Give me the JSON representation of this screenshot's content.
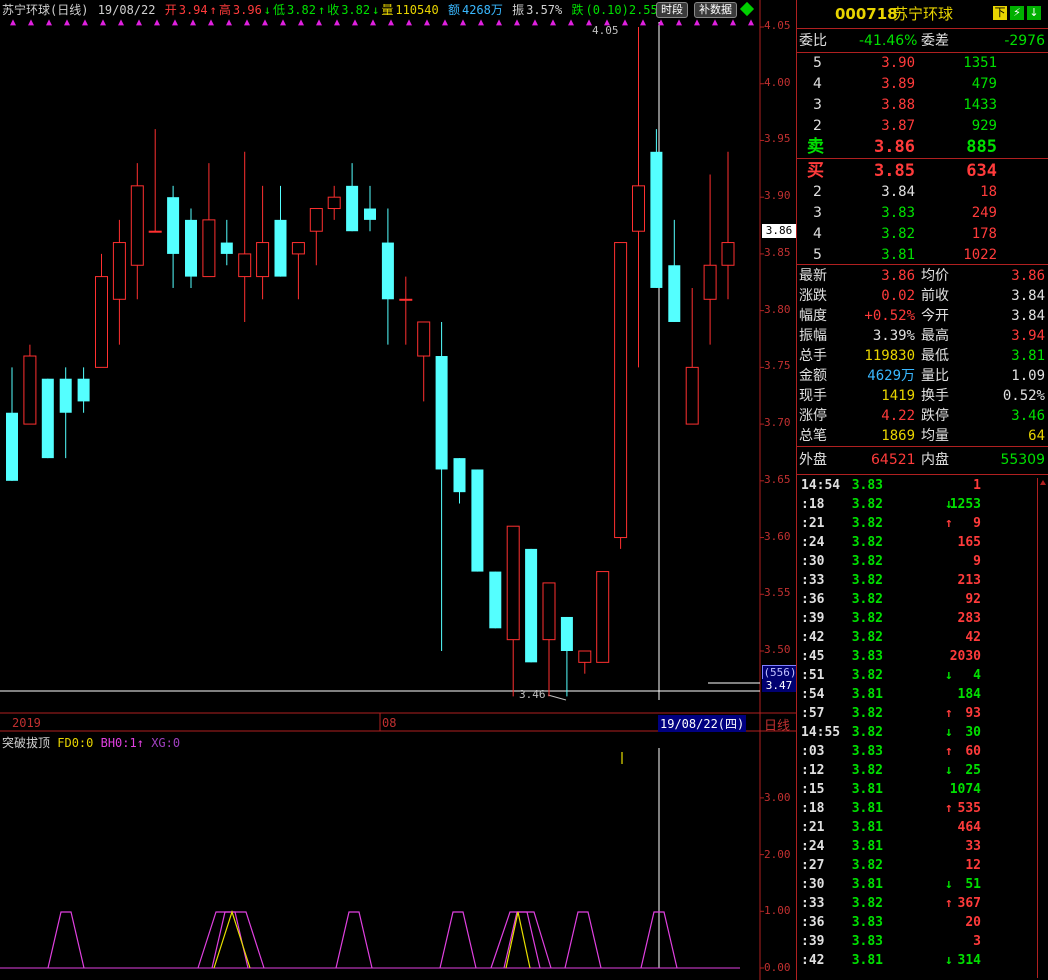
{
  "header": {
    "title": "苏宁环球(日线)",
    "date": "19/08/22",
    "open_label": "开",
    "open": "3.94",
    "high_label": "高",
    "high": "3.96",
    "low_label": "低",
    "low": "3.82",
    "close_label": "收",
    "close": "3.82",
    "vol_label": "量",
    "vol": "110540",
    "amt_label": "额",
    "amt": "4268万",
    "amp_label": "振",
    "amp": "3.57%",
    "chg_label": "跌",
    "chg": "(0.10)2.55%",
    "btn_period": "时段",
    "btn_supplement": "补数据"
  },
  "chart": {
    "y_ticks": [
      "4.05",
      "4.00",
      "3.95",
      "3.90",
      "3.85",
      "3.80",
      "3.75",
      "3.70",
      "3.65",
      "3.60",
      "3.55",
      "3.50"
    ],
    "current_price_tag": "3.86",
    "max_marker": "4.05",
    "min_marker": "3.46",
    "bottom_tag_1": "(556)",
    "bottom_tag_2": "3.47",
    "x_labels": [
      "2019",
      "08"
    ],
    "cursor_date": "19/08/22(四)",
    "period_label": "日线",
    "candles": [
      {
        "o": 3.71,
        "h": 3.75,
        "l": 3.65,
        "c": 3.65
      },
      {
        "o": 3.7,
        "h": 3.77,
        "l": 3.7,
        "c": 3.76
      },
      {
        "o": 3.74,
        "h": 3.74,
        "l": 3.67,
        "c": 3.67
      },
      {
        "o": 3.74,
        "h": 3.75,
        "l": 3.67,
        "c": 3.71
      },
      {
        "o": 3.74,
        "h": 3.75,
        "l": 3.71,
        "c": 3.72
      },
      {
        "o": 3.75,
        "h": 3.85,
        "l": 3.75,
        "c": 3.83
      },
      {
        "o": 3.81,
        "h": 3.88,
        "l": 3.77,
        "c": 3.86
      },
      {
        "o": 3.84,
        "h": 3.93,
        "l": 3.81,
        "c": 3.91
      },
      {
        "o": 3.87,
        "h": 3.96,
        "l": 3.87,
        "c": 3.87
      },
      {
        "o": 3.9,
        "h": 3.91,
        "l": 3.82,
        "c": 3.85
      },
      {
        "o": 3.88,
        "h": 3.89,
        "l": 3.82,
        "c": 3.83
      },
      {
        "o": 3.83,
        "h": 3.93,
        "l": 3.83,
        "c": 3.88
      },
      {
        "o": 3.86,
        "h": 3.88,
        "l": 3.84,
        "c": 3.85
      },
      {
        "o": 3.83,
        "h": 3.94,
        "l": 3.79,
        "c": 3.85
      },
      {
        "o": 3.83,
        "h": 3.91,
        "l": 3.81,
        "c": 3.86
      },
      {
        "o": 3.88,
        "h": 3.91,
        "l": 3.83,
        "c": 3.83
      },
      {
        "o": 3.85,
        "h": 3.86,
        "l": 3.81,
        "c": 3.86
      },
      {
        "o": 3.87,
        "h": 3.89,
        "l": 3.84,
        "c": 3.89
      },
      {
        "o": 3.89,
        "h": 3.91,
        "l": 3.88,
        "c": 3.9
      },
      {
        "o": 3.91,
        "h": 3.93,
        "l": 3.87,
        "c": 3.87
      },
      {
        "o": 3.89,
        "h": 3.91,
        "l": 3.87,
        "c": 3.88
      },
      {
        "o": 3.86,
        "h": 3.89,
        "l": 3.77,
        "c": 3.81
      },
      {
        "o": 3.81,
        "h": 3.83,
        "l": 3.77,
        "c": 3.81
      },
      {
        "o": 3.76,
        "h": 3.79,
        "l": 3.72,
        "c": 3.79
      },
      {
        "o": 3.76,
        "h": 3.79,
        "l": 3.5,
        "c": 3.66
      },
      {
        "o": 3.67,
        "h": 3.67,
        "l": 3.63,
        "c": 3.64
      },
      {
        "o": 3.66,
        "h": 3.66,
        "l": 3.57,
        "c": 3.57
      },
      {
        "o": 3.57,
        "h": 3.57,
        "l": 3.52,
        "c": 3.52
      },
      {
        "o": 3.51,
        "h": 3.61,
        "l": 3.46,
        "c": 3.61
      },
      {
        "o": 3.59,
        "h": 3.59,
        "l": 3.49,
        "c": 3.49
      },
      {
        "o": 3.51,
        "h": 3.56,
        "l": 3.46,
        "c": 3.56
      },
      {
        "o": 3.53,
        "h": 3.53,
        "l": 3.46,
        "c": 3.5
      },
      {
        "o": 3.49,
        "h": 3.5,
        "l": 3.48,
        "c": 3.5
      },
      {
        "o": 3.49,
        "h": 3.57,
        "l": 3.49,
        "c": 3.57
      },
      {
        "o": 3.6,
        "h": 3.86,
        "l": 3.59,
        "c": 3.86
      },
      {
        "o": 3.87,
        "h": 4.05,
        "l": 3.75,
        "c": 3.91
      },
      {
        "o": 3.94,
        "h": 3.96,
        "l": 3.82,
        "c": 3.82
      },
      {
        "o": 3.84,
        "h": 3.88,
        "l": 3.79,
        "c": 3.79
      },
      {
        "o": 3.7,
        "h": 3.82,
        "l": 3.7,
        "c": 3.75
      },
      {
        "o": 3.81,
        "h": 3.92,
        "l": 3.77,
        "c": 3.84
      },
      {
        "o": 3.84,
        "h": 3.94,
        "l": 3.81,
        "c": 3.86
      }
    ]
  },
  "indicator": {
    "name": "突破拔顶",
    "fd0": "FD0:0",
    "bh0": "BH0:1",
    "xg": "XG:0",
    "y_ticks": [
      "3.00",
      "2.00",
      "1.00",
      "0.00"
    ]
  },
  "quote": {
    "code": "000718",
    "name": "苏宁环球",
    "weibi_label": "委比",
    "weibi": "-41.46%",
    "weicha_label": "委差",
    "weicha": "-2976",
    "asks": [
      {
        "level": "5",
        "price": "3.90",
        "vol": "1351"
      },
      {
        "level": "4",
        "price": "3.89",
        "vol": "479"
      },
      {
        "level": "3",
        "price": "3.88",
        "vol": "1433"
      },
      {
        "level": "2",
        "price": "3.87",
        "vol": "929"
      },
      {
        "level": "卖",
        "price": "3.86",
        "vol": "885"
      }
    ],
    "bids": [
      {
        "level": "买",
        "price": "3.85",
        "vol": "634"
      },
      {
        "level": "2",
        "price": "3.84",
        "vol": "18"
      },
      {
        "level": "3",
        "price": "3.83",
        "vol": "249"
      },
      {
        "level": "4",
        "price": "3.82",
        "vol": "178"
      },
      {
        "level": "5",
        "price": "3.81",
        "vol": "1022"
      }
    ],
    "stats": [
      {
        "l1": "最新",
        "v1": "3.86",
        "c1": "red",
        "l2": "均价",
        "v2": "3.86",
        "c2": "red"
      },
      {
        "l1": "涨跌",
        "v1": "0.02",
        "c1": "red",
        "l2": "前收",
        "v2": "3.84",
        "c2": "wht"
      },
      {
        "l1": "幅度",
        "v1": "+0.52%",
        "c1": "red",
        "l2": "今开",
        "v2": "3.84",
        "c2": "wht"
      },
      {
        "l1": "振幅",
        "v1": "3.39%",
        "c1": "wht",
        "l2": "最高",
        "v2": "3.94",
        "c2": "red"
      },
      {
        "l1": "总手",
        "v1": "119830",
        "c1": "yel",
        "l2": "最低",
        "v2": "3.81",
        "c2": "grn"
      },
      {
        "l1": "金额",
        "v1": "4629万",
        "c1": "cyan",
        "l2": "量比",
        "v2": "1.09",
        "c2": "wht"
      },
      {
        "l1": "现手",
        "v1": "1419",
        "c1": "yel",
        "l2": "换手",
        "v2": "0.52%",
        "c2": "wht"
      },
      {
        "l1": "涨停",
        "v1": "4.22",
        "c1": "red",
        "l2": "跌停",
        "v2": "3.46",
        "c2": "grn"
      },
      {
        "l1": "总笔",
        "v1": "1869",
        "c1": "yel",
        "l2": "均量",
        "v2": "64",
        "c2": "yel"
      }
    ],
    "outer_label": "外盘",
    "outer": "64521",
    "inner_label": "内盘",
    "inner": "55309",
    "ticks": [
      {
        "t": "14:54",
        "p": "3.83",
        "pc": "grn",
        "a": "",
        "v": "1",
        "vc": "red"
      },
      {
        "t": ":18",
        "p": "3.82",
        "pc": "grn",
        "a": "↓",
        "v": "1253",
        "vc": "grn"
      },
      {
        "t": ":21",
        "p": "3.82",
        "pc": "grn",
        "a": "↑",
        "v": "9",
        "vc": "red"
      },
      {
        "t": ":24",
        "p": "3.82",
        "pc": "grn",
        "a": "",
        "v": "165",
        "vc": "red"
      },
      {
        "t": ":30",
        "p": "3.82",
        "pc": "grn",
        "a": "",
        "v": "9",
        "vc": "red"
      },
      {
        "t": ":33",
        "p": "3.82",
        "pc": "grn",
        "a": "",
        "v": "213",
        "vc": "red"
      },
      {
        "t": ":36",
        "p": "3.82",
        "pc": "grn",
        "a": "",
        "v": "92",
        "vc": "red"
      },
      {
        "t": ":39",
        "p": "3.82",
        "pc": "grn",
        "a": "",
        "v": "283",
        "vc": "red"
      },
      {
        "t": ":42",
        "p": "3.82",
        "pc": "grn",
        "a": "",
        "v": "42",
        "vc": "red"
      },
      {
        "t": ":45",
        "p": "3.83",
        "pc": "grn",
        "a": "",
        "v": "2030",
        "vc": "red"
      },
      {
        "t": ":51",
        "p": "3.82",
        "pc": "grn",
        "a": "↓",
        "v": "4",
        "vc": "grn"
      },
      {
        "t": ":54",
        "p": "3.81",
        "pc": "grn",
        "a": "",
        "v": "184",
        "vc": "grn"
      },
      {
        "t": ":57",
        "p": "3.82",
        "pc": "grn",
        "a": "↑",
        "v": "93",
        "vc": "red"
      },
      {
        "t": "14:55",
        "p": "3.82",
        "pc": "grn",
        "a": "↓",
        "v": "30",
        "vc": "grn"
      },
      {
        "t": ":03",
        "p": "3.83",
        "pc": "grn",
        "a": "↑",
        "v": "60",
        "vc": "red"
      },
      {
        "t": ":12",
        "p": "3.82",
        "pc": "grn",
        "a": "↓",
        "v": "25",
        "vc": "grn"
      },
      {
        "t": ":15",
        "p": "3.81",
        "pc": "grn",
        "a": "",
        "v": "1074",
        "vc": "grn"
      },
      {
        "t": ":18",
        "p": "3.81",
        "pc": "grn",
        "a": "↑",
        "v": "535",
        "vc": "red"
      },
      {
        "t": ":21",
        "p": "3.81",
        "pc": "grn",
        "a": "",
        "v": "464",
        "vc": "red"
      },
      {
        "t": ":24",
        "p": "3.81",
        "pc": "grn",
        "a": "",
        "v": "33",
        "vc": "red"
      },
      {
        "t": ":27",
        "p": "3.82",
        "pc": "grn",
        "a": "",
        "v": "12",
        "vc": "red"
      },
      {
        "t": ":30",
        "p": "3.81",
        "pc": "grn",
        "a": "↓",
        "v": "51",
        "vc": "grn"
      },
      {
        "t": ":33",
        "p": "3.82",
        "pc": "grn",
        "a": "↑",
        "v": "367",
        "vc": "red"
      },
      {
        "t": ":36",
        "p": "3.83",
        "pc": "grn",
        "a": "",
        "v": "20",
        "vc": "red"
      },
      {
        "t": ":39",
        "p": "3.83",
        "pc": "grn",
        "a": "",
        "v": "3",
        "vc": "red"
      },
      {
        "t": ":42",
        "p": "3.81",
        "pc": "grn",
        "a": "↓",
        "v": "314",
        "vc": "grn"
      }
    ]
  }
}
